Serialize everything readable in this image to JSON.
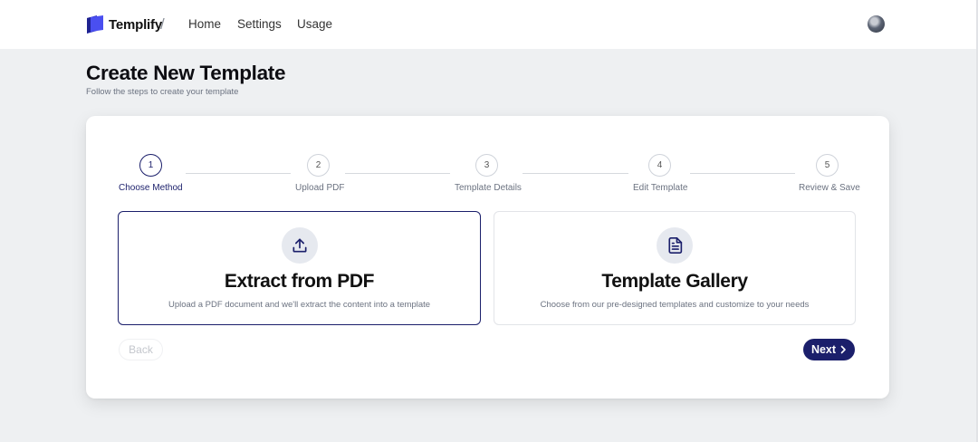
{
  "header": {
    "brand": "Templify",
    "separator": "/",
    "nav": [
      {
        "label": "Home"
      },
      {
        "label": "Settings"
      },
      {
        "label": "Usage"
      }
    ]
  },
  "page": {
    "title": "Create New Template",
    "subtitle": "Follow the steps to create your template"
  },
  "stepper": {
    "current_step": 1,
    "steps": [
      {
        "number": "1",
        "label": "Choose Method"
      },
      {
        "number": "2",
        "label": "Upload PDF"
      },
      {
        "number": "3",
        "label": "Template Details"
      },
      {
        "number": "4",
        "label": "Edit Template"
      },
      {
        "number": "5",
        "label": "Review & Save"
      }
    ]
  },
  "options": [
    {
      "title": "Extract from PDF",
      "description": "Upload a PDF document and we'll extract the content into a template",
      "icon": "upload-icon",
      "selected": true
    },
    {
      "title": "Template Gallery",
      "description": "Choose from our pre-designed templates and customize to your needs",
      "icon": "document-icon",
      "selected": false
    }
  ],
  "actions": {
    "back_label": "Back",
    "next_label": "Next"
  },
  "colors": {
    "accent": "#1b1f6b",
    "page_background": "#eef0f2",
    "brand_logo": "#3b3fd8"
  }
}
